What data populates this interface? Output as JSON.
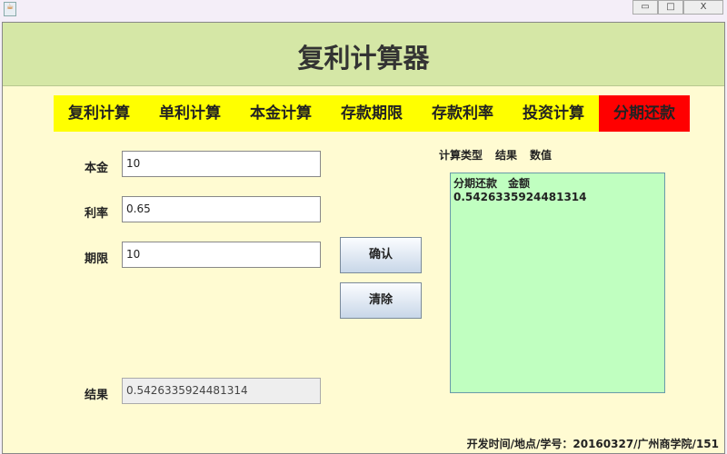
{
  "window": {
    "minimize": "▭",
    "maximize": "□",
    "close": "X"
  },
  "header": {
    "title": "复利计算器"
  },
  "tabs": [
    {
      "label": "复利计算"
    },
    {
      "label": "单利计算"
    },
    {
      "label": "本金计算"
    },
    {
      "label": "存款期限"
    },
    {
      "label": "存款利率"
    },
    {
      "label": "投资计算"
    },
    {
      "label": "分期还款",
      "active": true
    }
  ],
  "form": {
    "principal": {
      "label": "本金",
      "value": "10"
    },
    "rate": {
      "label": "利率",
      "value": "0.65"
    },
    "term": {
      "label": "期限",
      "value": "10"
    },
    "result": {
      "label": "结果",
      "value": "0.5426335924481314"
    }
  },
  "buttons": {
    "confirm": "确认",
    "clear": "清除"
  },
  "results": {
    "headers": [
      "计算类型",
      "结果",
      "数值"
    ],
    "rows": [
      [
        "分期还款",
        "金额",
        "0.5426335924481314"
      ]
    ]
  },
  "footer": "开发时间/地点/学号：20160327/广州商学院/151",
  "colors": {
    "header": "#d5e7a6",
    "tabs": "#ffff00",
    "active_tab": "#ff0000",
    "background": "#fffbd2",
    "result_box": "#c0ffc0"
  }
}
